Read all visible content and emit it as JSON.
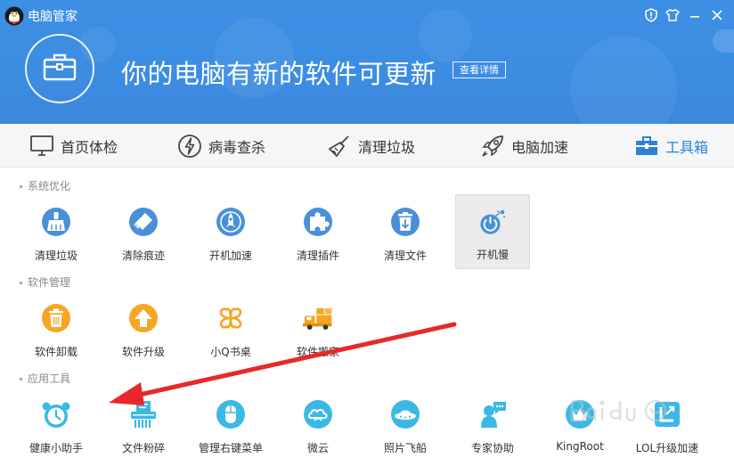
{
  "window": {
    "title": "电脑管家",
    "controls": [
      "shield-icon",
      "shirt-icon",
      "minimize-icon",
      "close-icon"
    ]
  },
  "hero": {
    "message": "你的电脑有新的软件可更新",
    "button_label": "查看详情",
    "icon": "toolbox-icon"
  },
  "nav": {
    "tabs": [
      {
        "label": "首页体检",
        "icon": "monitor-icon",
        "active": false
      },
      {
        "label": "病毒查杀",
        "icon": "lightning-icon",
        "active": false
      },
      {
        "label": "清理垃圾",
        "icon": "broom-icon",
        "active": false
      },
      {
        "label": "电脑加速",
        "icon": "rocket-icon",
        "active": false
      },
      {
        "label": "工具箱",
        "icon": "toolbox-icon",
        "active": true
      }
    ]
  },
  "sections": [
    {
      "title": "系统优化",
      "tools": [
        {
          "label": "清理垃圾",
          "icon": "broom-icon",
          "color": "#4a90d9"
        },
        {
          "label": "清除痕迹",
          "icon": "eraser-icon",
          "color": "#4a90d9"
        },
        {
          "label": "开机加速",
          "icon": "rocket-icon",
          "color": "#4a90d9"
        },
        {
          "label": "清理插件",
          "icon": "puzzle-icon",
          "color": "#4a90d9"
        },
        {
          "label": "清理文件",
          "icon": "trash-download-icon",
          "color": "#4a90d9"
        },
        {
          "label": "开机慢",
          "icon": "power-gear-icon",
          "color": "#4a90d9",
          "selected": true
        }
      ]
    },
    {
      "title": "软件管理",
      "tools": [
        {
          "label": "软件卸载",
          "icon": "trash-icon",
          "color": "#f5a623"
        },
        {
          "label": "软件升级",
          "icon": "arrow-up-icon",
          "color": "#f5a623"
        },
        {
          "label": "小Q书桌",
          "icon": "clover-icon",
          "color": "#f5a623"
        },
        {
          "label": "软件搬家",
          "icon": "truck-icon",
          "color": "#f5a623"
        }
      ]
    },
    {
      "title": "应用工具",
      "tools": [
        {
          "label": "健康小助手",
          "icon": "alarm-clock-icon",
          "color": "#3bb8e6"
        },
        {
          "label": "文件粉碎",
          "icon": "shredder-icon",
          "color": "#3bb8e6"
        },
        {
          "label": "管理右键菜单",
          "icon": "mouse-icon",
          "color": "#3bb8e6"
        },
        {
          "label": "微云",
          "icon": "cloud-icon",
          "color": "#3bb8e6"
        },
        {
          "label": "照片飞船",
          "icon": "ufo-icon",
          "color": "#3bb8e6"
        },
        {
          "label": "专家协助",
          "icon": "expert-chat-icon",
          "color": "#3bb8e6"
        },
        {
          "label": "KingRoot",
          "icon": "kingroot-icon",
          "color": "#3bb8e6"
        },
        {
          "label": "LOL升级加速",
          "icon": "lol-icon",
          "color": "#3bb8e6"
        }
      ]
    }
  ],
  "colors": {
    "banner": "#3c8de2",
    "nav_active": "#2b83d8",
    "annotation_arrow": "#e8282b"
  }
}
